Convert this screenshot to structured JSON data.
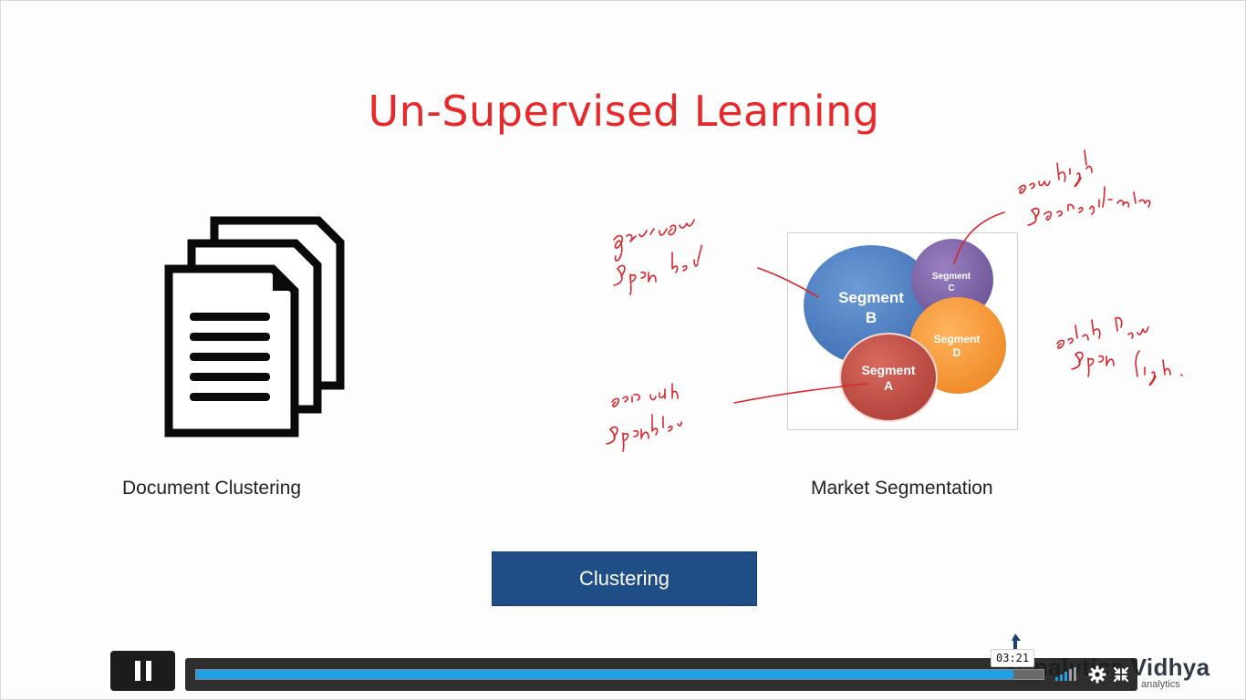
{
  "slide": {
    "title": "Un-Supervised Learning",
    "left_caption": "Document Clustering",
    "right_caption": "Market Segmentation",
    "center_box": "Clustering"
  },
  "venn": {
    "segments": [
      {
        "name_line1": "Segment",
        "name_line2": "B",
        "color": "#4e80c4"
      },
      {
        "name_line1": "Segment",
        "name_line2": "C",
        "color": "#8166a9"
      },
      {
        "name_line1": "Segment",
        "name_line2": "D",
        "color": "#f79b3e"
      },
      {
        "name_line1": "Segment",
        "name_line2": "A",
        "color": "#c5524a"
      }
    ]
  },
  "branding": {
    "name": "nalytics Vidhya",
    "sub": "analytics"
  },
  "player": {
    "time_tooltip": "03:21",
    "progress_fraction": 0.965,
    "accent_color": "#1ea0e6",
    "icons": [
      "pause-icon",
      "volume-icon",
      "gear-icon",
      "fullscreen-exit-icon"
    ]
  },
  "colors": {
    "title": "#e8292b",
    "annotation_ink": "#d9262b",
    "clustering_box": "#1f4e87"
  }
}
